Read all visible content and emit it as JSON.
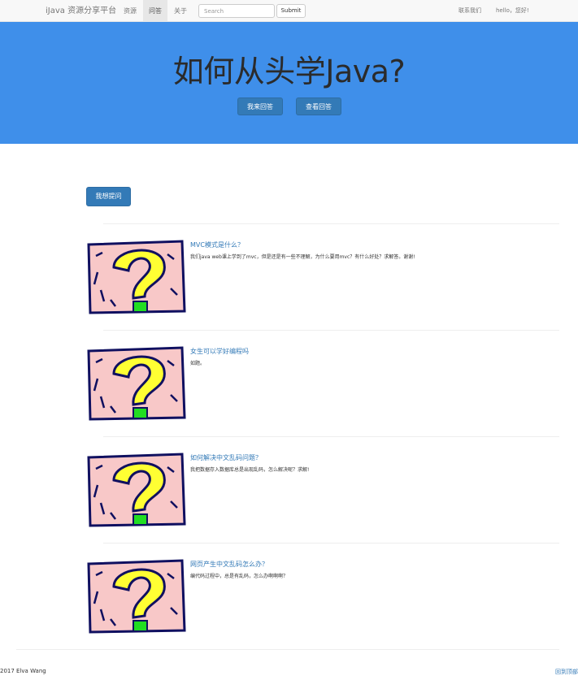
{
  "navbar": {
    "brand": "iJava 资源分享平台",
    "items": [
      {
        "label": "资源",
        "active": false
      },
      {
        "label": "问答",
        "active": true
      },
      {
        "label": "关于",
        "active": false
      }
    ],
    "search": {
      "placeholder": "Search",
      "value": ""
    },
    "submit_label": "Submit",
    "contact": "联系我们",
    "greeting": "hello，您好!"
  },
  "jumbotron": {
    "title": "如何从头学Java?",
    "answer_button": "我来回答",
    "view_button": "查看回答"
  },
  "ask_button": "我想提问",
  "questions": [
    {
      "title": "MVC模式是什么？",
      "description": "我们java web课上学到了mvc，但是还是有一些不理解，为什么要用mvc？有什么好处？求解答。谢谢!"
    },
    {
      "title": "女生可以学好编程吗",
      "description": "如题。"
    },
    {
      "title": "如何解决中文乱码问题？",
      "description": "我把数据存入数据库总是出现乱码，怎么解决呢？求解!"
    },
    {
      "title": "网页产生中文乱码怎么办？",
      "description": "编代码过程中，总是有乱码，怎么办啊啊啊？"
    }
  ],
  "footer": {
    "copyright": "2017 Elva Wang",
    "back_to_top": "回到顶部"
  },
  "colors": {
    "jumbotron_bg": "#3f8fea",
    "primary": "#337ab7",
    "link": "#337ab7"
  },
  "icons": {
    "question_image": "question-mark-icon"
  }
}
